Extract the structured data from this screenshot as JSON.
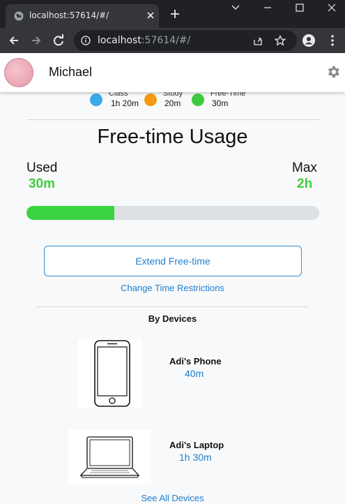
{
  "browser": {
    "tab_title": "localhost:57614/#/",
    "url_host": "localhost",
    "url_rest": ":57614/#/"
  },
  "header": {
    "username": "Michael"
  },
  "legend": [
    {
      "name": "Class",
      "value": "1h 20m",
      "color": "#3aa9e8"
    },
    {
      "name": "Study",
      "value": "20m",
      "color": "#f59a11"
    },
    {
      "name": "Free-Time",
      "value": "30m",
      "color": "#3dcb3d"
    }
  ],
  "usage": {
    "title": "Free-time Usage",
    "used_label": "Used",
    "used_value": "30m",
    "max_label": "Max",
    "max_value": "2h",
    "progress_fraction": 0.3,
    "fill_color": "#39d43f"
  },
  "actions": {
    "extend_label": "Extend Free-time",
    "change_restrictions_label": "Change Time Restrictions"
  },
  "devices": {
    "section_title": "By Devices",
    "items": [
      {
        "name": "Adi's Phone",
        "time": "40m",
        "icon": "phone-icon"
      },
      {
        "name": "Adi's Laptop",
        "time": "1h 30m",
        "icon": "laptop-icon"
      }
    ],
    "see_all_label": "See All Devices"
  }
}
